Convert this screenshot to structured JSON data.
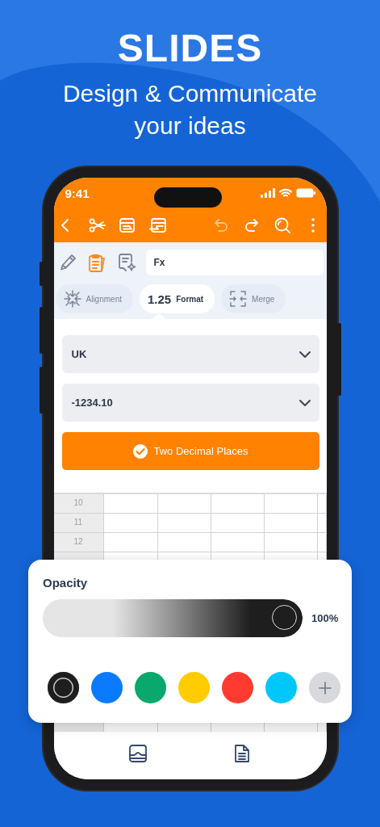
{
  "headline": {
    "title": "SLIDES",
    "subtitle": "Design & Communicate your ideas"
  },
  "status_bar": {
    "time": "9:41"
  },
  "toolbar": [
    {
      "kind": "back",
      "disabled": false
    },
    {
      "kind": "cut",
      "disabled": false
    },
    {
      "kind": "table-out",
      "disabled": false
    },
    {
      "kind": "table-in",
      "disabled": false
    },
    {
      "kind": "undo",
      "disabled": true
    },
    {
      "kind": "redo",
      "disabled": false
    },
    {
      "kind": "search",
      "disabled": false
    },
    {
      "kind": "more",
      "disabled": false
    }
  ],
  "edit_tools": [
    {
      "kind": "pencil",
      "selected": false
    },
    {
      "kind": "clipboard",
      "selected": true
    },
    {
      "kind": "comment",
      "selected": false
    }
  ],
  "formula_bar": {
    "label": "Fx"
  },
  "chips": [
    {
      "kind": "alignment",
      "label": "Alignment",
      "selected": false
    },
    {
      "kind": "format",
      "value": "1.25",
      "label": "Format",
      "selected": true
    },
    {
      "kind": "merge",
      "label": "Merge",
      "selected": false
    }
  ],
  "dropdowns": [
    {
      "value": "UK"
    },
    {
      "value": "-1234.10"
    }
  ],
  "apply_button": {
    "label": "Two Decimal Places"
  },
  "grid": {
    "rows": [
      "10",
      "11",
      "12"
    ]
  },
  "opacity_popup": {
    "title": "Opacity",
    "level": 1.0,
    "reading": "100%",
    "colors": [
      {
        "color": "#1e1e1e",
        "selected": true
      },
      {
        "color": "#0a7aff",
        "selected": false
      },
      {
        "color": "#0aa86c",
        "selected": false
      },
      {
        "color": "#ffcc00",
        "selected": false
      },
      {
        "color": "#ff3b30",
        "selected": false
      },
      {
        "color": "#00c7fa",
        "selected": false
      }
    ]
  },
  "tab_bar": [
    {
      "kind": "sheet"
    },
    {
      "kind": "document"
    }
  ]
}
